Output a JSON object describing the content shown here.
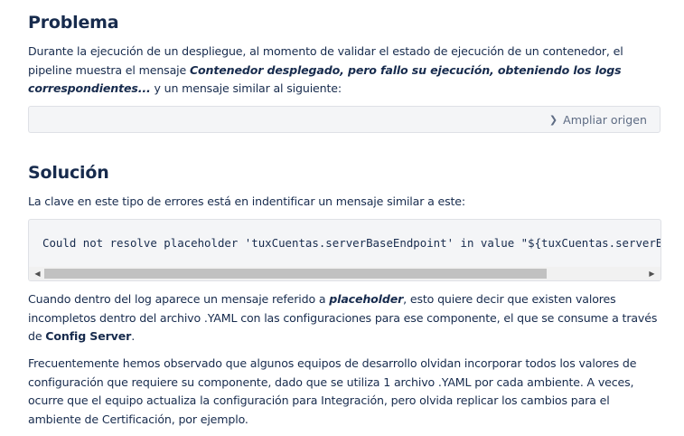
{
  "problema": {
    "heading": "Problema",
    "intro_part1": "Durante la ejecución de un despliegue, al momento de validar el estado de ejecución de un contenedor, el pipeline muestra el mensaje ",
    "intro_emphasis": "Contenedor desplegado, pero fallo su ejecución, obteniendo los logs correspondientes...",
    "intro_part2": " y un mensaje similar al siguiente:",
    "expand_label": "Ampliar origen"
  },
  "solucion": {
    "heading": "Solución",
    "clave": "La clave en este tipo de errores está en indentificar un mensaje similar a este:",
    "code": "Could not resolve placeholder 'tuxCuentas.serverBaseEndpoint' in value \"${tuxCuentas.serverBaseEndpoint}\"",
    "cuando_part1": "Cuando dentro del log aparece un mensaje referido a ",
    "cuando_emphasis": "placeholder",
    "cuando_part2": ", esto quiere decir que existen valores incompletos dentro del archivo .YAML con las configuraciones para ese componente, el que se consume a través de ",
    "cuando_strong": "Config Server",
    "cuando_part3": ".",
    "frecuente": "Frecuentemente hemos observado que algunos equipos de desarrollo olvidan incorporar todos los valores de configuración que requiere su componente, dado que se utiliza 1 archivo .YAML por cada ambiente. A veces, ocurre que el equipo actualiza la configuración para Integración, pero olvida replicar los cambios para el ambiente de Certificación, por ejemplo."
  },
  "icons": {
    "expand": "chevron-right-icon",
    "scroll_left": "arrow-left-icon",
    "scroll_right": "arrow-right-icon"
  }
}
